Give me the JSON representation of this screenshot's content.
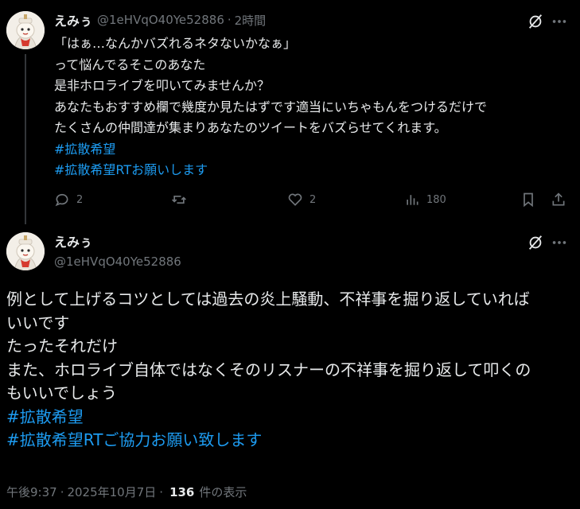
{
  "tweet1": {
    "display_name": "えみぅ",
    "handle": "@1eHVqO40Ye52886",
    "separator": "·",
    "time": "2時間",
    "lines": [
      "「はぁ…なんかバズれるネタないかなぁ」",
      "って悩んでるそこのあなた",
      "是非ホロライブを叩いてみませんか？",
      "あなたもおすすめ欄で幾度か見たはずです適当にいちゃもんをつけるだけで",
      "たくさんの仲間達が集まりあなたのツイートをバズらせてくれます。"
    ],
    "hashtags": [
      "#拡散希望",
      "#拡散希望RTお願いします"
    ],
    "actions": {
      "replies": "2",
      "likes": "2",
      "views": "180"
    }
  },
  "tweet2": {
    "display_name": "えみぅ",
    "handle": "@1eHVqO40Ye52886",
    "lines": [
      "例として上げるコツとしては過去の炎上騒動、不祥事を掘り返していれば",
      "いいです",
      "たったそれだけ",
      "また、ホロライブ自体ではなくそのリスナーの不祥事を掘り返して叩くの",
      "もいいでしょう"
    ],
    "hashtags": [
      "#拡散希望",
      "#拡散希望RTご協力お願い致します"
    ],
    "meta": {
      "time": "午後9:37",
      "separator1": "·",
      "date": "2025年10月7日",
      "separator2": "·",
      "views_count": "136",
      "views_label": "件の表示"
    }
  },
  "colors": {
    "background": "#000000",
    "text": "#e7e9ea",
    "muted": "#71767b",
    "link": "#1d9bf0",
    "thread_line": "#333639"
  },
  "icons": [
    "grok-icon",
    "more-icon",
    "reply-icon",
    "retweet-icon",
    "like-icon",
    "views-icon",
    "bookmark-icon",
    "share-icon"
  ]
}
